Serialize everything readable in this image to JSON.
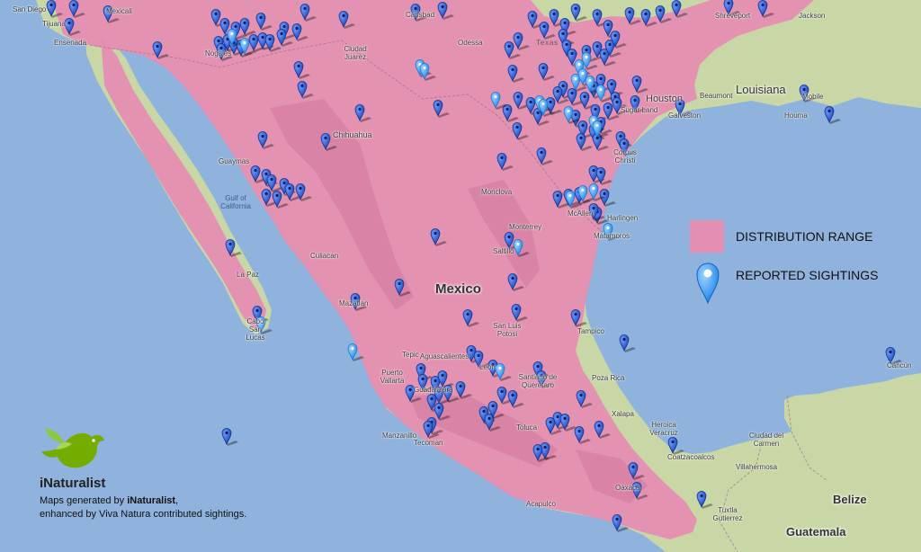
{
  "map": {
    "country_main": "Mexico",
    "country_belize": "Belize",
    "country_guatemala": "Guatemala",
    "colors": {
      "ocean": "#8fb3dc",
      "land": "#c9d7a6",
      "range": "#e48fb1",
      "sighting": "#2d5fd6",
      "highlighted_sighting": "#2e8ff0"
    },
    "cities": [
      "San Diego",
      "Tijuana",
      "Ensenada",
      "Mexicali",
      "Nogales",
      "Ciudad Juarez",
      "Carlsbad",
      "Odessa",
      "Shreveport",
      "Jackson",
      "Beaumont",
      "Louisiana",
      "Houma",
      "Mobile",
      "Houston",
      "Sugar Land",
      "Galveston",
      "Chihuahua",
      "Guaymas",
      "Gulf of California",
      "Monclova",
      "Culiacan",
      "La Paz",
      "Cabo San Lucas",
      "Mazatlan",
      "Monterrey",
      "Saltillo",
      "Matamoros",
      "Corpus Christi",
      "McAllen",
      "Harlingen",
      "Tampico",
      "San Luis Potosi",
      "Aguascalientes",
      "Leon",
      "Tepic",
      "Puerto Vallarta",
      "Guadalajara",
      "Santiago de Queretaro",
      "Poza Rica",
      "Xalapa",
      "Heroica Veracruz",
      "Manzanillo",
      "Tecoman",
      "Toluca",
      "Acapulco",
      "Oaxaca",
      "Coatzacoalcos",
      "Villahermosa",
      "Ciudad del Carmen",
      "Tuxtla Gutierrez",
      "Cancún",
      "Texas"
    ],
    "pins_count": 175
  },
  "legend": {
    "range_label": "DISTRIBUTION RANGE",
    "sightings_label": "REPORTED SIGHTINGS"
  },
  "branding": {
    "name": "iNaturalist",
    "credit_prefix": "Maps generated by ",
    "credit_brand": "iNaturalist",
    "credit_suffix": ",",
    "credit_line_2": "enhanced by Viva Natura contributed sightings."
  }
}
